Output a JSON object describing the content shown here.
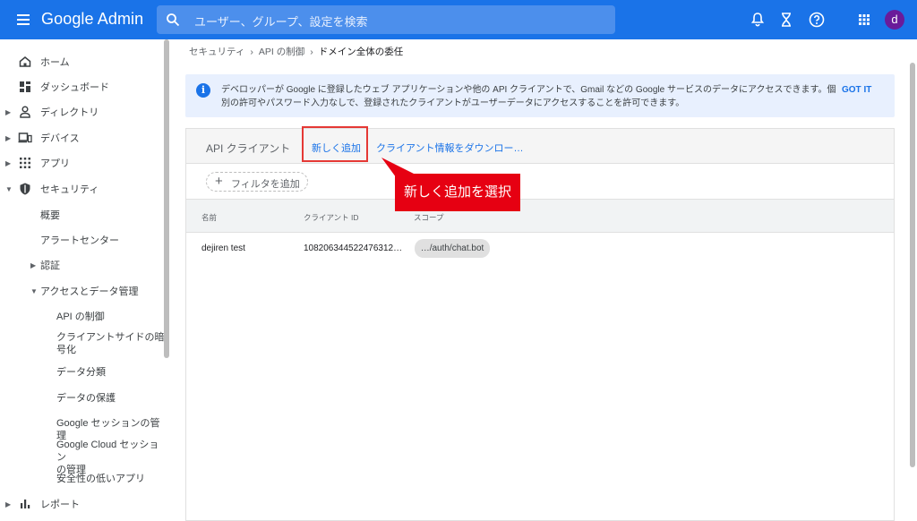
{
  "header": {
    "brand": "Google Admin",
    "search_placeholder": "ユーザー、グループ、設定を検索",
    "avatar_letter": "d"
  },
  "sidebar": {
    "items": [
      {
        "label": "ホーム",
        "icon": "home-icon"
      },
      {
        "label": "ダッシュボード",
        "icon": "dashboard-icon"
      },
      {
        "label": "ディレクトリ",
        "icon": "person-icon"
      },
      {
        "label": "デバイス",
        "icon": "devices-icon"
      },
      {
        "label": "アプリ",
        "icon": "apps-grid-icon"
      },
      {
        "label": "セキュリティ",
        "icon": "shield-icon"
      }
    ],
    "security_sub": {
      "overview": "概要",
      "alert_center": "アラートセンター",
      "auth": "認証",
      "access_data": "アクセスとデータ管理",
      "api_control": "API の制御",
      "client_encryption_1": "クライアントサイドの暗",
      "client_encryption_2": "号化",
      "data_classification": "データ分類",
      "data_protection": "データの保護",
      "google_session": "Google セッションの管理",
      "cloud_session_1": "Google Cloud セッション",
      "cloud_session_2": "の管理",
      "less_secure_apps": "安全性の低いアプリ"
    },
    "reports": "レポート"
  },
  "breadcrumb": {
    "item1": "セキュリティ",
    "item2": "API の制御",
    "current": "ドメイン全体の委任",
    "separator": "›"
  },
  "banner": {
    "line1": "デベロッパーが Google に登録したウェブ アプリケーションや他の API クライアントで、Gmail などの Google サービスのデータにアクセスできます。個",
    "line2": "別の許可やパスワード入力なしで、登録されたクライアントがユーザーデータにアクセスすることを許可できます。",
    "got_it": "GOT IT"
  },
  "panel": {
    "title": "API クライアント",
    "add_new": "新しく追加",
    "download": "クライアント情報をダウンロー…",
    "filter_add": "フィルタを追加",
    "columns": {
      "name": "名前",
      "client_id": "クライアント ID",
      "scope": "スコープ"
    },
    "rows": [
      {
        "name": "dejiren test",
        "client_id": "108206344522476312…",
        "scope": "…/auth/chat.bot"
      }
    ]
  },
  "annotation": {
    "callout": "新しく追加を選択",
    "color": "#e60012"
  }
}
